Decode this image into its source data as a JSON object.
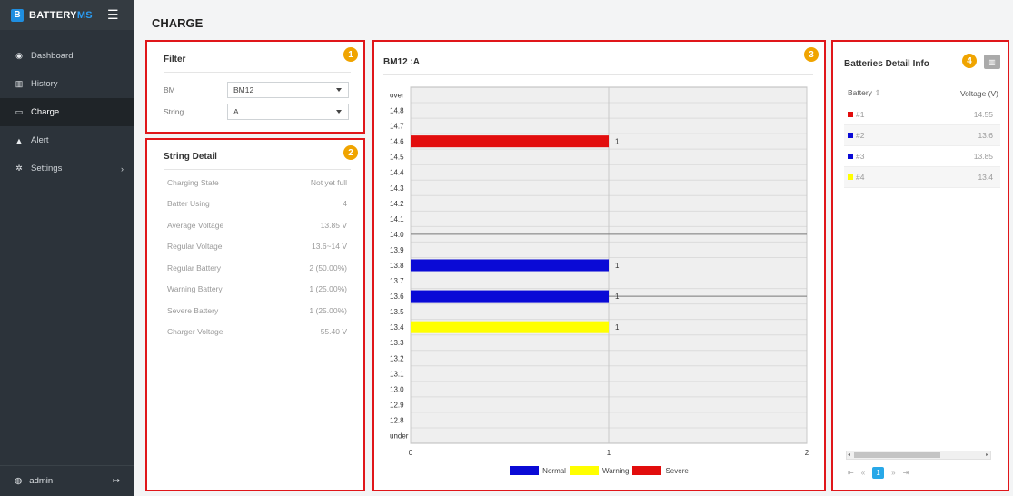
{
  "brand": {
    "letter": "B",
    "name_main": "BATTERY",
    "name_accent": "MS"
  },
  "sidebar": {
    "items": [
      {
        "label": "Dashboard",
        "icon": "dashboard-icon",
        "glyph": "◉"
      },
      {
        "label": "History",
        "icon": "bar-chart-icon",
        "glyph": "▥"
      },
      {
        "label": "Charge",
        "icon": "battery-icon",
        "glyph": "▭"
      },
      {
        "label": "Alert",
        "icon": "warning-icon",
        "glyph": "▲"
      },
      {
        "label": "Settings",
        "icon": "gear-icon",
        "glyph": "✲"
      }
    ],
    "user": "admin"
  },
  "page": {
    "title": "CHARGE"
  },
  "badges": [
    "1",
    "2",
    "3",
    "4"
  ],
  "filter": {
    "title": "Filter",
    "bm_label": "BM",
    "bm_value": "BM12",
    "string_label": "String",
    "string_value": "A"
  },
  "string_detail": {
    "title": "String Detail",
    "rows": [
      {
        "label": "Charging State",
        "value": "Not yet full"
      },
      {
        "label": "Batter Using",
        "value": "4"
      },
      {
        "label": "Average Voltage",
        "value": "13.85 V"
      },
      {
        "label": "Regular Voltage",
        "value": "13.6~14 V"
      },
      {
        "label": "Regular Battery",
        "value": "2 (50.00%)"
      },
      {
        "label": "Warning Battery",
        "value": "1 (25.00%)"
      },
      {
        "label": "Severe Battery",
        "value": "1 (25.00%)"
      },
      {
        "label": "Charger Voltage",
        "value": "55.40 V"
      }
    ]
  },
  "chart_panel": {
    "title": "BM12 :A"
  },
  "chart_data": {
    "type": "bar",
    "orientation": "horizontal",
    "categories": [
      "over",
      "14.8",
      "14.7",
      "14.6",
      "14.5",
      "14.4",
      "14.3",
      "14.2",
      "14.1",
      "14.0",
      "13.9",
      "13.8",
      "13.7",
      "13.6",
      "13.5",
      "13.4",
      "13.3",
      "13.2",
      "13.1",
      "13.0",
      "12.9",
      "12.8",
      "under"
    ],
    "bars": [
      {
        "category": "14.6",
        "value": 1,
        "label": "1",
        "status": "Severe"
      },
      {
        "category": "13.8",
        "value": 1,
        "label": "1",
        "status": "Normal"
      },
      {
        "category": "13.6",
        "value": 1,
        "label": "1",
        "status": "Normal"
      },
      {
        "category": "13.4",
        "value": 1,
        "label": "1",
        "status": "Warning"
      }
    ],
    "reference_lines": [
      "14.0",
      "13.6"
    ],
    "xlim": [
      0,
      2
    ],
    "xticks": [
      "0",
      "1",
      "2"
    ],
    "legend": [
      {
        "name": "Normal",
        "color": "#0a0ad6"
      },
      {
        "name": "Warning",
        "color": "#ffff00"
      },
      {
        "name": "Severe",
        "color": "#e20d0d"
      }
    ],
    "legend_position": "bottom",
    "grid": true
  },
  "detail_info": {
    "title": "Batteries Detail Info",
    "col_battery": "Battery",
    "sort_glyph": "⇕",
    "col_voltage": "Voltage (V)",
    "rows": [
      {
        "battery": "#1",
        "voltage": "14.55",
        "color": "#e20d0d"
      },
      {
        "battery": "#2",
        "voltage": "13.6",
        "color": "#0a0ad6"
      },
      {
        "battery": "#3",
        "voltage": "13.85",
        "color": "#0a0ad6"
      },
      {
        "battery": "#4",
        "voltage": "13.4",
        "color": "#ffff00"
      }
    ],
    "pager": {
      "first": "⇤",
      "prev": "«",
      "current": "1",
      "next": "»",
      "last": "⇥"
    }
  }
}
